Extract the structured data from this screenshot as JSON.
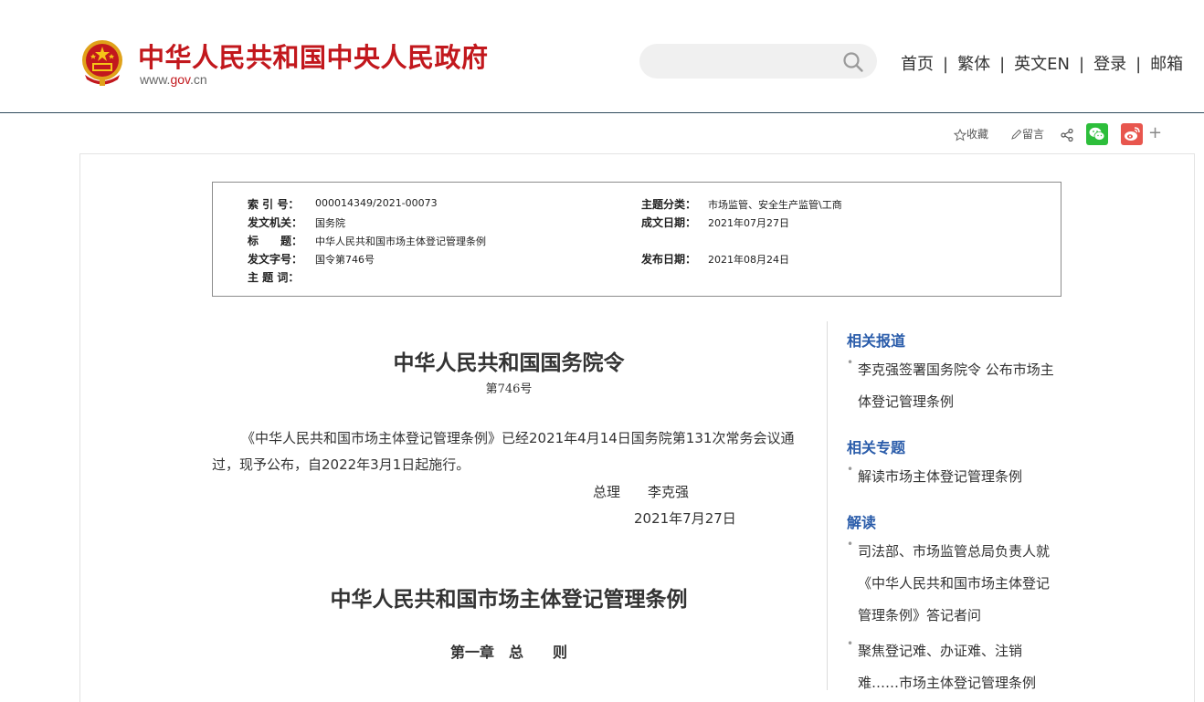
{
  "header": {
    "site_title": "中华人民共和国中央人民政府",
    "url_prefix": "www.",
    "url_highlight": "gov",
    "url_suffix": ".cn",
    "search_placeholder": "",
    "nav": [
      "首页",
      "繁体",
      "英文EN",
      "登录",
      "邮箱"
    ],
    "nav_separator": "|"
  },
  "share_bar": {
    "favorite_label": "收藏",
    "comment_label": "留言",
    "plus_label": "+"
  },
  "meta": {
    "index_no_label": "索 引 号：",
    "index_no": "000014349/2021-00073",
    "topic_label": "主题分类：",
    "topic": "市场监管、安全生产监管\\工商",
    "issuer_label": "发文机关：",
    "issuer": "国务院",
    "created_label": "成文日期：",
    "created": "2021年07月27日",
    "title_label": "标　　题：",
    "title": "中华人民共和国市场主体登记管理条例",
    "doc_no_label": "发文字号：",
    "doc_no": "国令第746号",
    "published_label": "发布日期：",
    "published": "2021年08月24日",
    "keywords_label": "主 题 词：",
    "keywords": ""
  },
  "article": {
    "order_title": "中华人民共和国国务院令",
    "order_number": "第746号",
    "paragraph": "《中华人民共和国市场主体登记管理条例》已经2021年4月14日国务院第131次常务会议通过，现予公布，自2022年3月1日起施行。",
    "signer": "总理　　李克强",
    "sign_date": "2021年7月27日",
    "regulation_title": "中华人民共和国市场主体登记管理条例",
    "chapter_heading": "第一章　总　　则"
  },
  "sidebar": {
    "sections": [
      {
        "heading": "相关报道",
        "items": [
          "李克强签署国务院令 公布市场主体登记管理条例"
        ]
      },
      {
        "heading": "相关专题",
        "items": [
          "解读市场主体登记管理条例"
        ]
      },
      {
        "heading": "解读",
        "items": [
          "司法部、市场监管总局负责人就《中华人民共和国市场主体登记管理条例》答记者问",
          "聚焦登记难、办证难、注销难……市场主体登记管理条例"
        ]
      }
    ]
  },
  "colors": {
    "brand_red": "#c2181d",
    "link_blue": "#2a5caa",
    "wechat_green": "#2dbe3b",
    "weibo_red": "#e8564e"
  }
}
